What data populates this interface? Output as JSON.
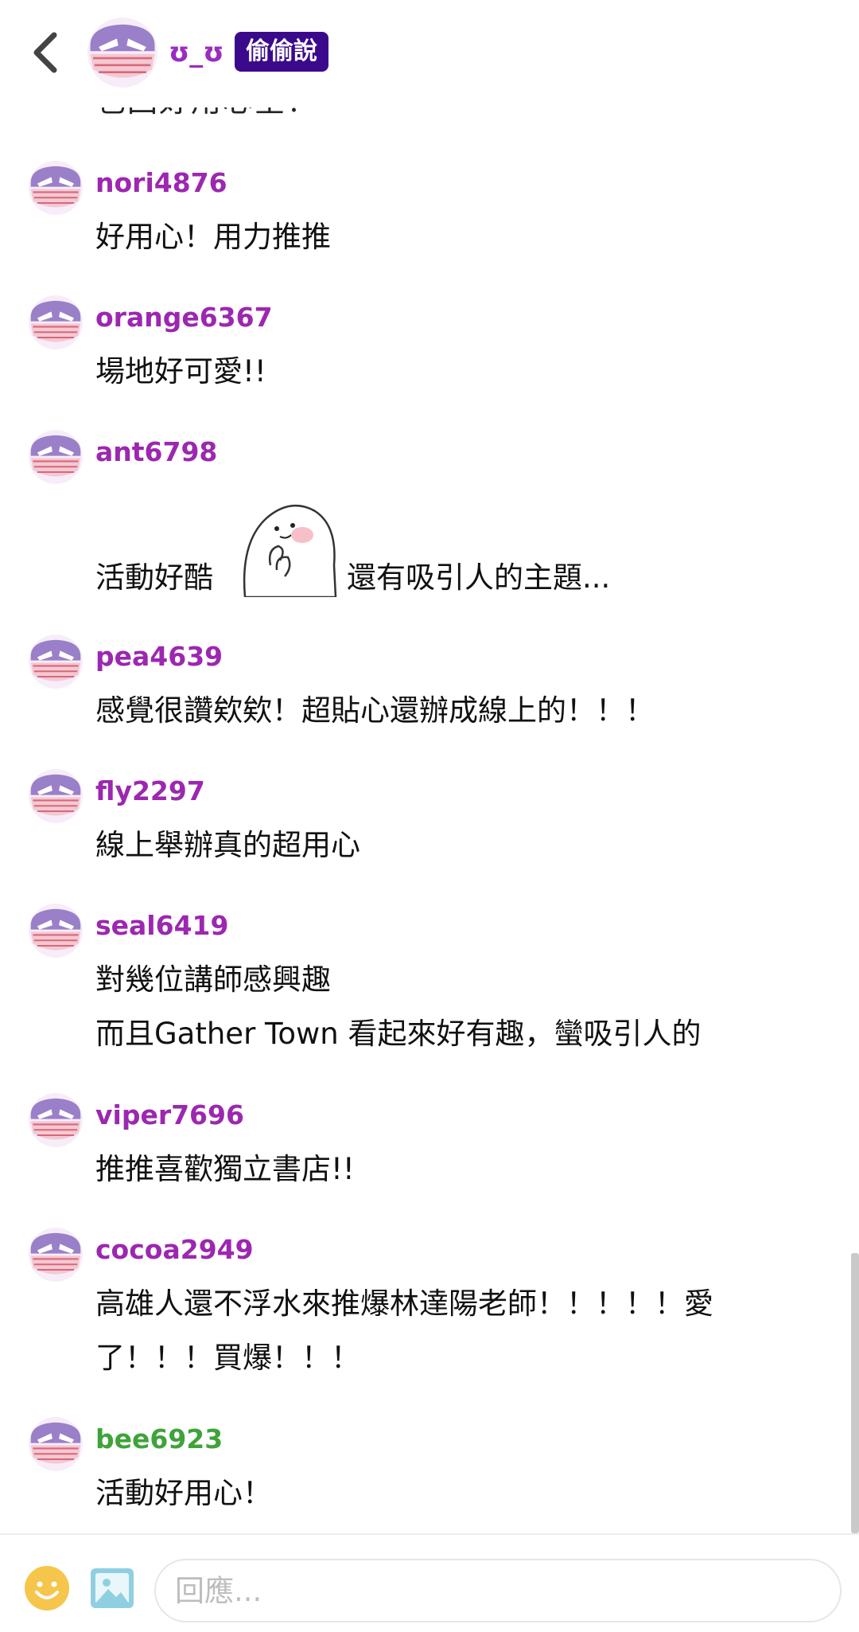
{
  "header": {
    "name": "ʊ_ʊ",
    "badge": "偷偷說",
    "cut_off_text": "也回好用心呈！"
  },
  "comments": [
    {
      "user": "nori4876",
      "lines": [
        "好用心！用力推推"
      ],
      "user_color": "purple"
    },
    {
      "user": "orange6367",
      "lines": [
        "場地好可愛!!"
      ],
      "user_color": "purple"
    },
    {
      "user": "ant6798",
      "text_before": "活動好酷",
      "sticker": "ghost-sticker",
      "text_after": "還有吸引人的主題...",
      "user_color": "purple"
    },
    {
      "user": "pea4639",
      "lines": [
        "感覺很讚欸欸！超貼心還辦成線上的！！！"
      ],
      "user_color": "purple"
    },
    {
      "user": "fly2297",
      "lines": [
        "線上舉辦真的超用心"
      ],
      "user_color": "purple"
    },
    {
      "user": "seal6419",
      "lines": [
        "對幾位講師感興趣",
        "而且Gather Town 看起來好有趣，蠻吸引人的"
      ],
      "user_color": "purple"
    },
    {
      "user": "viper7696",
      "lines": [
        "推推喜歡獨立書店!!"
      ],
      "user_color": "purple"
    },
    {
      "user": "cocoa2949",
      "lines": [
        "高雄人還不浮水來推爆林達陽老師！！！！！愛",
        "了！！！買爆！！！"
      ],
      "user_color": "purple"
    },
    {
      "user": "bee6923",
      "lines": [
        "活動好用心！"
      ],
      "user_color": "green"
    }
  ],
  "reply": {
    "placeholder": "回應...",
    "value": ""
  },
  "icons": {
    "back": "chevron-left-icon",
    "emoji": "smiley-icon",
    "image": "image-icon"
  },
  "colors": {
    "username_purple": "#9c27b0",
    "username_green": "#3fa33a",
    "badge_bg": "#3b0a8c"
  }
}
